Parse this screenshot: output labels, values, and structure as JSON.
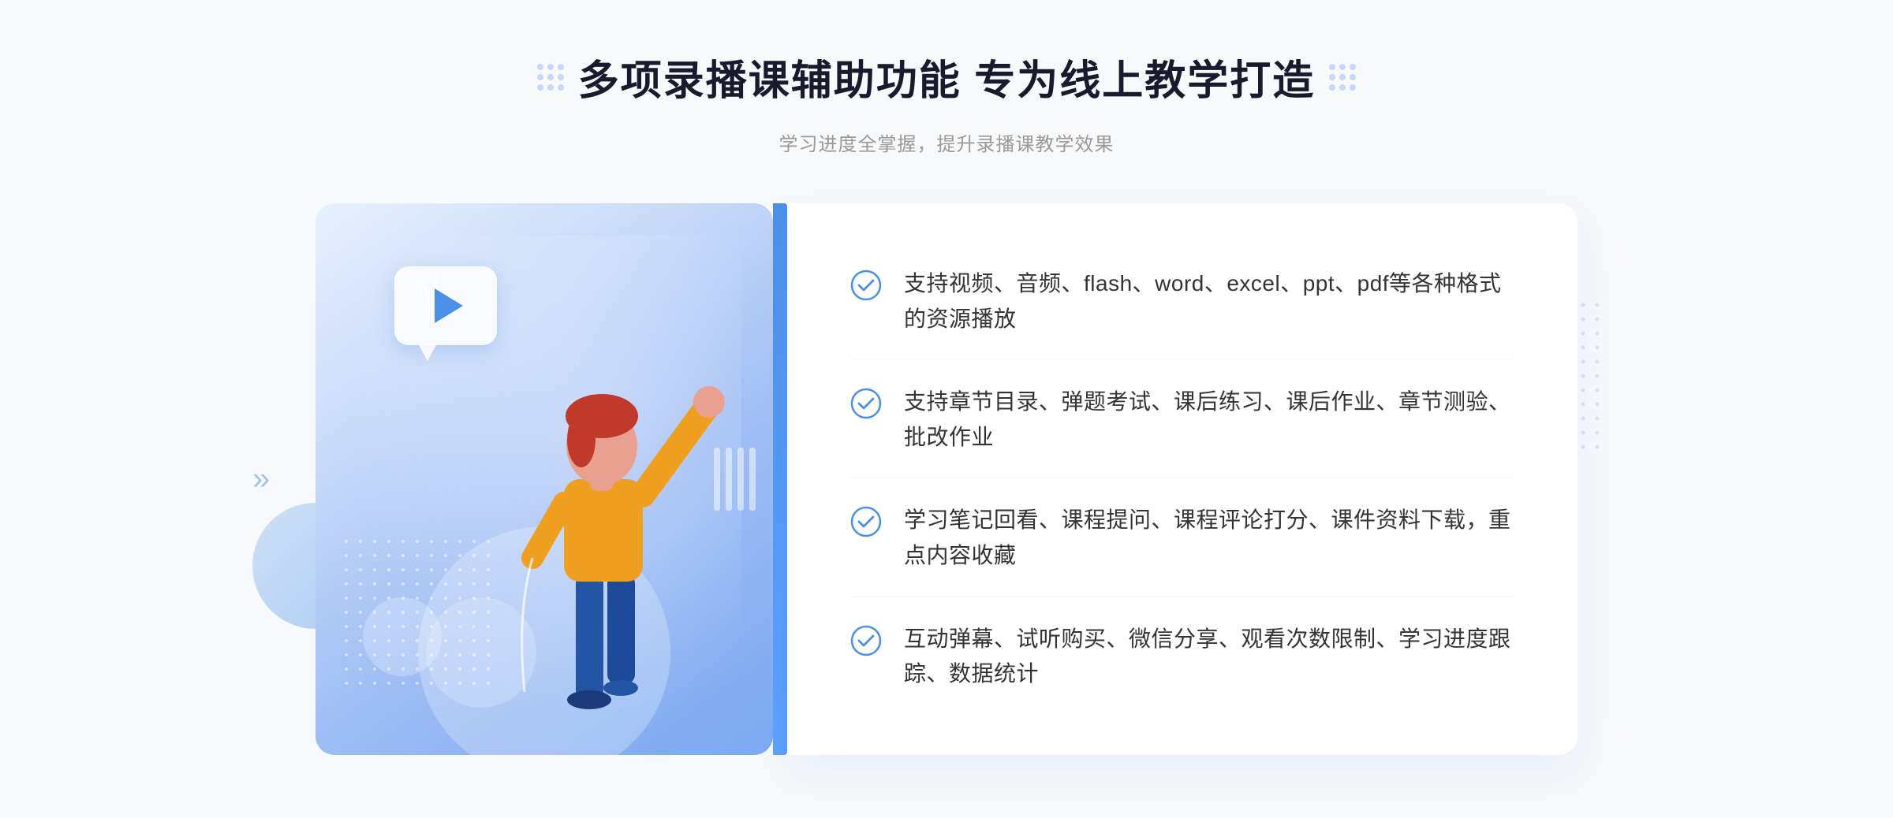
{
  "header": {
    "main_title": "多项录播课辅助功能 专为线上教学打造",
    "sub_title": "学习进度全掌握，提升录播课教学效果"
  },
  "features": [
    {
      "id": "feature-1",
      "text": "支持视频、音频、flash、word、excel、ppt、pdf等各种格式的资源播放"
    },
    {
      "id": "feature-2",
      "text": "支持章节目录、弹题考试、课后练习、课后作业、章节测验、批改作业"
    },
    {
      "id": "feature-3",
      "text": "学习笔记回看、课程提问、课程评论打分、课件资料下载，重点内容收藏"
    },
    {
      "id": "feature-4",
      "text": "互动弹幕、试听购买、微信分享、观看次数限制、学习进度跟踪、数据统计"
    }
  ],
  "colors": {
    "primary_blue": "#4a90e8",
    "light_blue": "#7aaee8",
    "check_blue": "#4a90e8",
    "title_dark": "#1a1a2e",
    "subtitle_gray": "#999999",
    "text_dark": "#333333",
    "card_bg": "#ffffff",
    "illustration_gradient_start": "#e8f0fe",
    "illustration_gradient_end": "#7aa8f0"
  },
  "icons": {
    "check_circle": "check-circle-icon",
    "play": "play-icon",
    "chevron_left": "chevron-left-icon"
  }
}
